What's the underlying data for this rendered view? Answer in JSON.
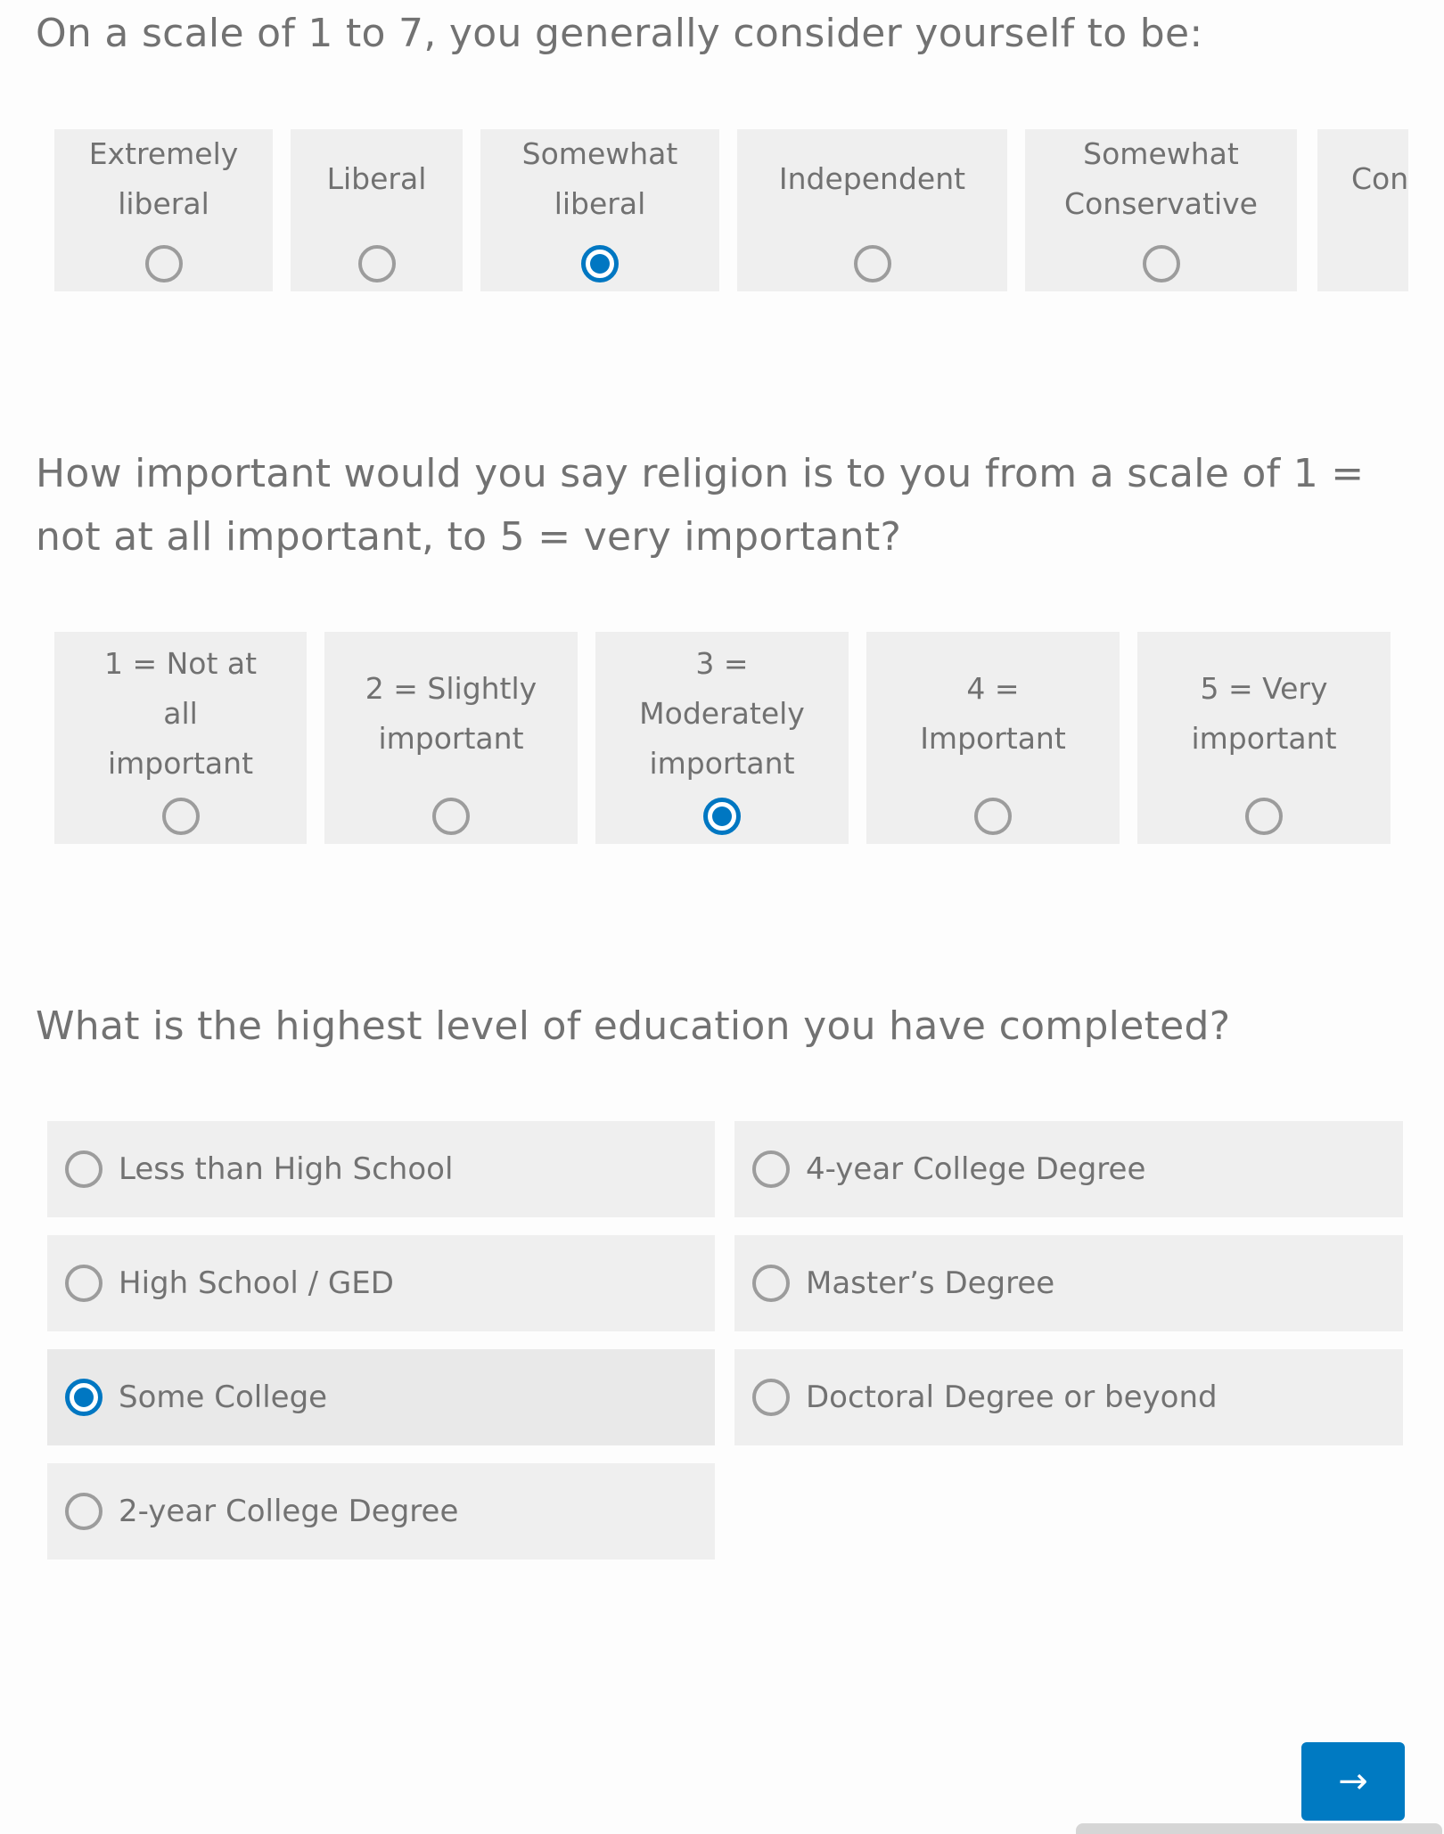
{
  "colors": {
    "accent": "#007ac2",
    "tile_bg": "#efefef",
    "tile_selected_bg": "#e9e9e9",
    "text": "#727272",
    "radio_unchecked": "#9c9c9c",
    "page_bg": "#fdfdfd"
  },
  "q1": {
    "title": "On a scale of 1 to 7, you generally consider yourself to be:",
    "selected_index": 2,
    "options": [
      {
        "label": "Extremely\nliberal",
        "selected": false
      },
      {
        "label": "Liberal",
        "selected": false
      },
      {
        "label": "Somewhat\nliberal",
        "selected": true
      },
      {
        "label": "Independent",
        "selected": false
      },
      {
        "label": "Somewhat\nConservative",
        "selected": false
      },
      {
        "label": "Conservative",
        "selected": false
      }
    ]
  },
  "q2": {
    "title": "How important would you say religion is to you from a scale of 1 = not at all important, to 5 = very important?",
    "selected_index": 2,
    "options": [
      {
        "label": "1 = Not at\nall\nimportant",
        "selected": false
      },
      {
        "label": "2 = Slightly\nimportant",
        "selected": false
      },
      {
        "label": "3 =\nModerately\nimportant",
        "selected": true
      },
      {
        "label": "4 =\nImportant",
        "selected": false
      },
      {
        "label": "5 = Very\nimportant",
        "selected": false
      }
    ]
  },
  "q3": {
    "title": "What is the highest level of education you have completed?",
    "selected_index": 2,
    "options": [
      {
        "label": "Less than High School",
        "selected": false
      },
      {
        "label": "High School / GED",
        "selected": false
      },
      {
        "label": "Some College",
        "selected": true
      },
      {
        "label": "2-year College Degree",
        "selected": false
      },
      {
        "label": "4-year College Degree",
        "selected": false
      },
      {
        "label": "Master’s Degree",
        "selected": false
      },
      {
        "label": "Doctoral Degree or beyond",
        "selected": false
      }
    ]
  },
  "navigation": {
    "next_icon": "arrow-right-icon",
    "next_glyph": "→"
  }
}
